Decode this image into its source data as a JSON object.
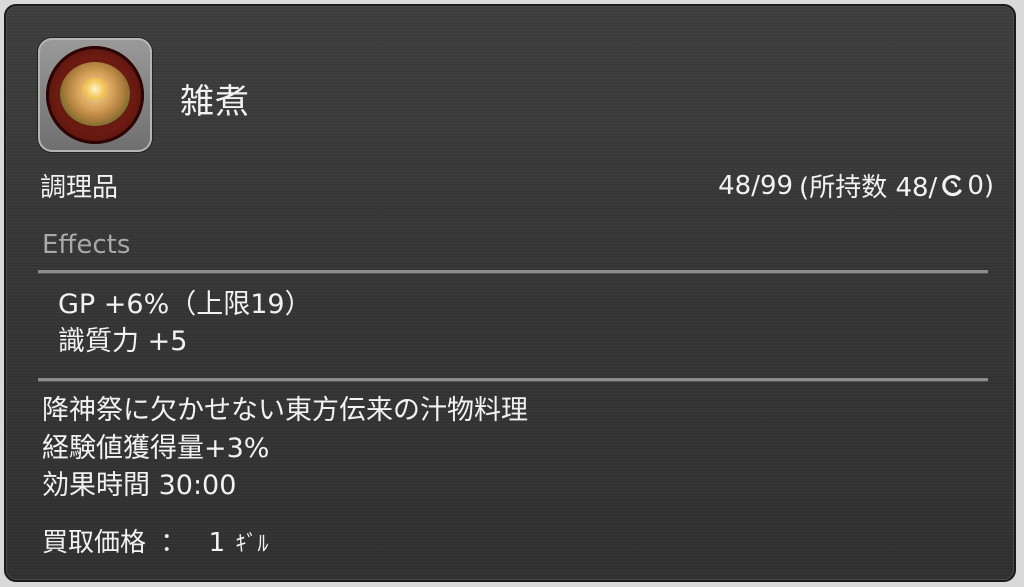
{
  "item": {
    "name": "雑煮",
    "category": "調理品",
    "icon": "zoni-bowl-icon",
    "stack": {
      "count_text": "48/99",
      "owned_text": "(所持数 48/",
      "hq_icon": "hq-icon",
      "hq_count_text": "0)"
    }
  },
  "effects": {
    "label": "Effects",
    "lines": [
      "GP +6%（上限19）",
      "識質力 +5"
    ]
  },
  "description": {
    "lines": [
      "降神祭に欠かせない東方伝来の汁物料理",
      "経験値獲得量+3%",
      "効果時間 30:00"
    ]
  },
  "price": {
    "label": "買取価格",
    "separator": "：",
    "value": "1",
    "currency_icon": "gil-icon",
    "currency_glyph": "ｷﾞﾙ"
  },
  "colors": {
    "panel_bg": "#353535",
    "text": "#f2f2f2",
    "section_label": "#a9a9a9",
    "divider": "#8c8c8c"
  }
}
